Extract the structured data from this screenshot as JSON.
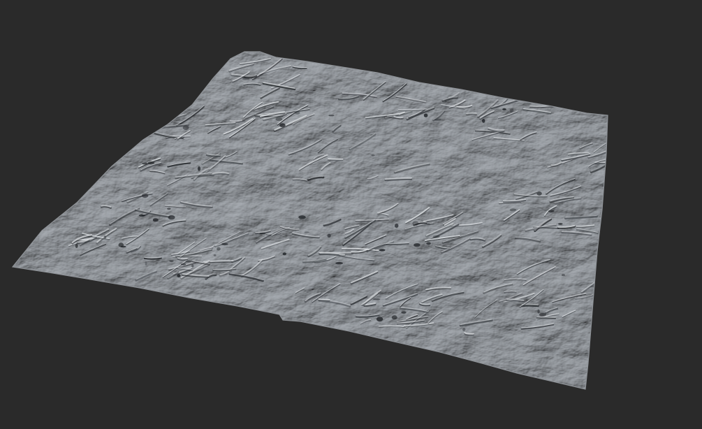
{
  "viewport": {
    "background_color": "#2a2a2a"
  },
  "terrain": {
    "surface_color": "#b4b8bd",
    "highlight_color": "#dde0e3",
    "shadow_color": "#3a3e43",
    "deep_shadow_color": "#1f2226"
  }
}
